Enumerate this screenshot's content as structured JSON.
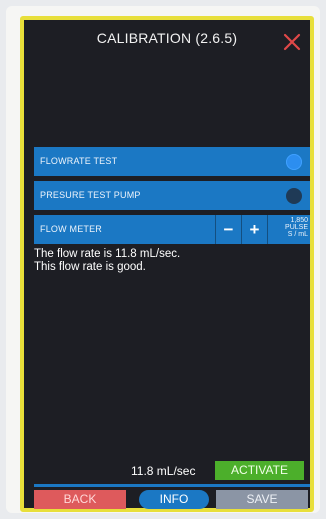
{
  "header": {
    "title": "CALIBRATION (2.6.5)",
    "close_icon": "close-icon"
  },
  "rows": {
    "flowrate_test": {
      "label": "FLOWRATE TEST",
      "toggle_on": true
    },
    "pressure_test_pump": {
      "label": "PRESURE TEST PUMP",
      "toggle_on": false
    },
    "flow_meter": {
      "label": "FLOW METER",
      "minus_label": "−",
      "plus_label": "+",
      "pulse_value": "1,850",
      "pulse_unit_line1": "PULSE",
      "pulse_unit_line2": "S / mL"
    }
  },
  "messages": {
    "line1": "The flow rate is 11.8 mL/sec.",
    "line2": "This flow rate is good."
  },
  "footer": {
    "readout": "11.8 mL/sec",
    "activate_label": "ACTIVATE",
    "back_label": "BACK",
    "info_label": "INFO",
    "save_label": "SAVE"
  },
  "colors": {
    "frame": "#e8df3a",
    "screen_bg": "#1d1e24",
    "row_blue": "#1b78c4",
    "activate_green": "#4caf2b",
    "back_red": "#de5a5c",
    "save_gray": "#8b95a5",
    "close_red": "#e04848"
  }
}
